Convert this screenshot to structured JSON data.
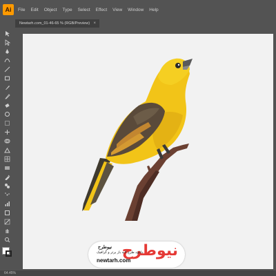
{
  "menubar": {
    "logo": "Ai",
    "items": [
      "File",
      "Edit",
      "Object",
      "Type",
      "Select",
      "Effect",
      "View",
      "Window",
      "Help"
    ]
  },
  "document_tab": {
    "title": "Newtarh.com_01-46-65 % (RGB/Preview)",
    "close_symbol": "×"
  },
  "toolbar": {
    "tools": [
      "selection-icon",
      "direct-selection-icon",
      "pen-icon",
      "curvature-icon",
      "line-icon",
      "rectangle-icon",
      "brush-icon",
      "pencil-icon",
      "eraser-icon",
      "rotate-icon",
      "scale-icon",
      "width-icon",
      "shape-builder-icon",
      "perspective-icon",
      "mesh-icon",
      "gradient-icon",
      "eyedropper-icon",
      "blend-icon",
      "symbol-sprayer-icon",
      "graph-icon",
      "artboard-icon",
      "slice-icon",
      "hand-icon",
      "zoom-icon"
    ]
  },
  "statusbar": {
    "zoom": "64.45%"
  },
  "watermark": {
    "logo_text": "نیوطرح",
    "name": "نیوطرح",
    "slogan": "دانلود طرح لایه باز برتر و گرافیک",
    "site": "newtarh.com"
  },
  "colors": {
    "bird_yellow": "#f2c418",
    "wing_brown": "#5a4a3a",
    "branch": "#6b4032",
    "accent_red": "#e53935"
  }
}
